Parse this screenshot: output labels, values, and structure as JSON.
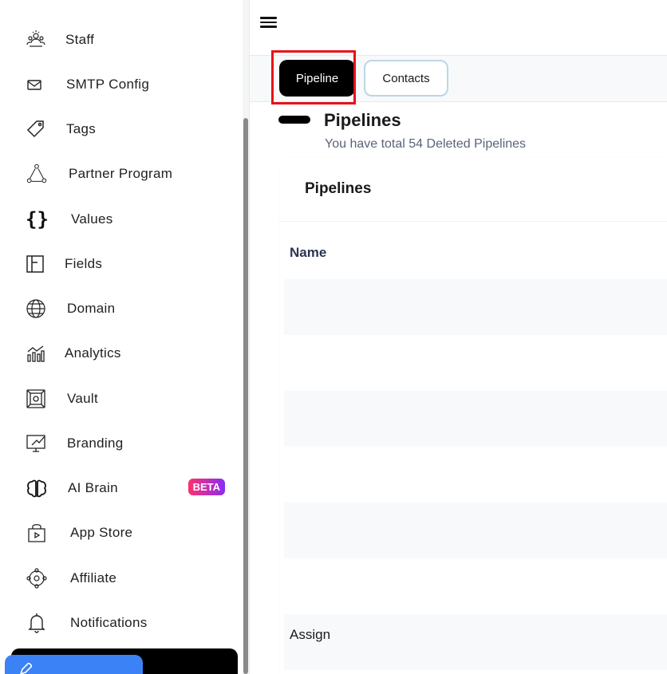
{
  "sidebar": {
    "items": [
      {
        "label": "Staff",
        "icon": "staff-icon"
      },
      {
        "label": "SMTP Config",
        "icon": "mail-icon"
      },
      {
        "label": "Tags",
        "icon": "tag-icon"
      },
      {
        "label": "Partner Program",
        "icon": "partner-icon"
      },
      {
        "label": "Values",
        "icon": "braces-icon"
      },
      {
        "label": "Fields",
        "icon": "fields-icon"
      },
      {
        "label": "Domain",
        "icon": "globe-icon"
      },
      {
        "label": "Analytics",
        "icon": "analytics-icon"
      },
      {
        "label": "Vault",
        "icon": "vault-icon"
      },
      {
        "label": "Branding",
        "icon": "branding-icon"
      },
      {
        "label": "AI Brain",
        "icon": "brain-icon",
        "badge": "BETA"
      },
      {
        "label": "App Store",
        "icon": "appstore-icon"
      },
      {
        "label": "Affiliate",
        "icon": "affiliate-icon"
      },
      {
        "label": "Notifications",
        "icon": "bell-icon"
      }
    ]
  },
  "tabs": [
    {
      "label": "Pipeline",
      "active": true
    },
    {
      "label": "Contacts",
      "active": false
    }
  ],
  "page": {
    "title": "Pipelines",
    "subtitle": "You have total 54 Deleted Pipelines"
  },
  "card": {
    "title": "Pipelines",
    "columns": [
      "Name"
    ],
    "rows": [
      "",
      "",
      "",
      "",
      "",
      "",
      "Assign"
    ]
  },
  "colors": {
    "accent_dark": "#000000",
    "highlight": "#e8101a",
    "beta_gradient_start": "#ff2f6d",
    "beta_gradient_end": "#8b2cf5",
    "blue_button": "#3b82f6"
  }
}
